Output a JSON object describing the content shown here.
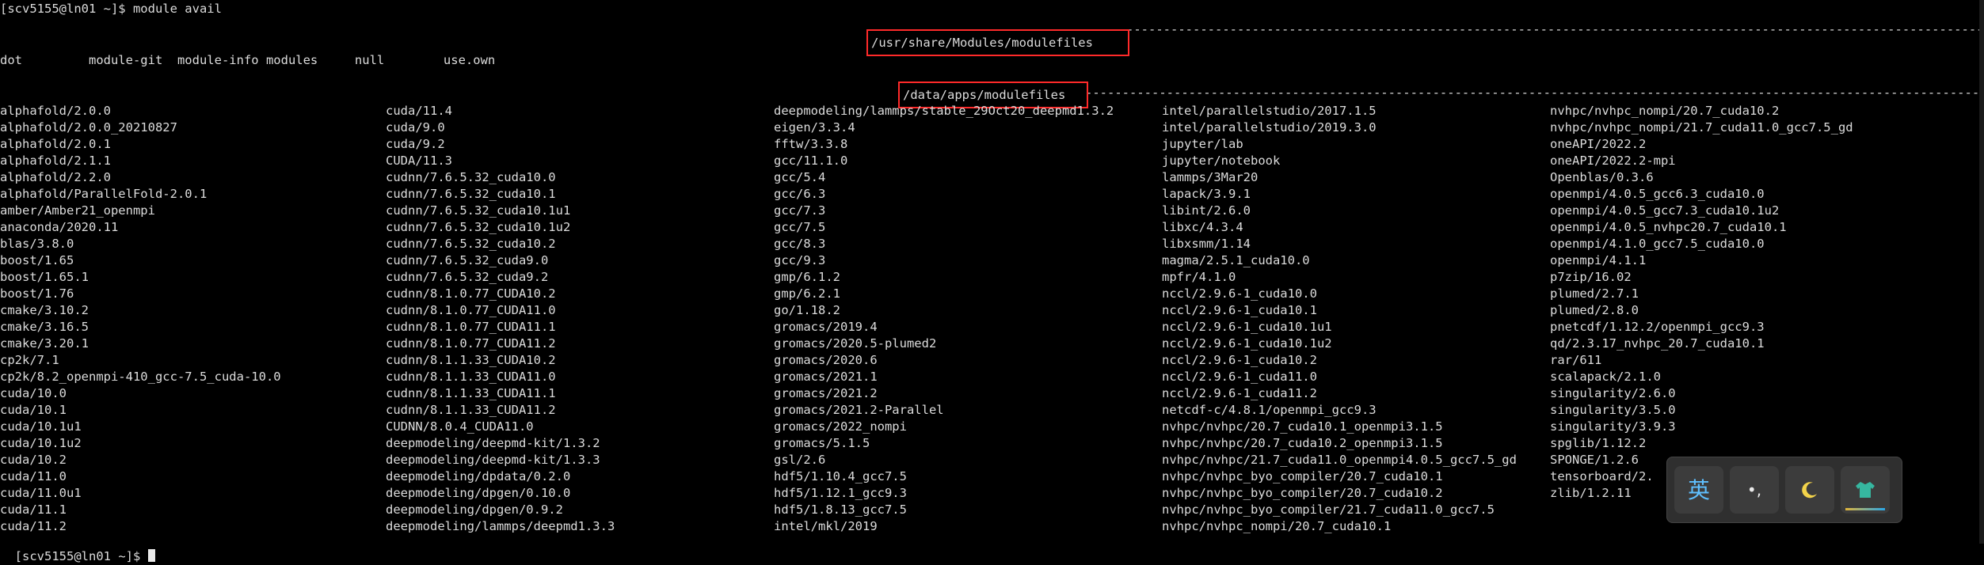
{
  "prompt_line": "[scv5155@ln01 ~]$ module avail",
  "last_prompt": "[scv5155@ln01 ~]$ ",
  "section1": {
    "path": "/usr/share/Modules/modulefiles",
    "dashes_left": "----------------------------------------------------------------------------------------------------------------------------------------------------------------------",
    "dashes_right": "----------------------------------------------------------------------------------------------------------------------------------------------------------------------------",
    "items": "dot         module-git  module-info modules     null        use.own"
  },
  "section2": {
    "path": "/data/apps/modulefiles",
    "dashes_left": "------------------------------------------------------------------------------------------------------------------------------------------------------------------------------",
    "dashes_right": "------------------------------------------------------------------------------------------------------------------------------------------------------------------------------------------------------------------------"
  },
  "columns": [
    [
      "alphafold/2.0.0",
      "alphafold/2.0.0_20210827",
      "alphafold/2.0.1",
      "alphafold/2.1.1",
      "alphafold/2.2.0",
      "alphafold/ParallelFold-2.0.1",
      "amber/Amber21_openmpi",
      "anaconda/2020.11",
      "blas/3.8.0",
      "boost/1.65",
      "boost/1.65.1",
      "boost/1.76",
      "cmake/3.10.2",
      "cmake/3.16.5",
      "cmake/3.20.1",
      "cp2k/7.1",
      "cp2k/8.2_openmpi-410_gcc-7.5_cuda-10.0",
      "cuda/10.0",
      "cuda/10.1",
      "cuda/10.1u1",
      "cuda/10.1u2",
      "cuda/10.2",
      "cuda/11.0",
      "cuda/11.0u1",
      "cuda/11.1",
      "cuda/11.2"
    ],
    [
      "cuda/11.4",
      "cuda/9.0",
      "cuda/9.2",
      "CUDA/11.3",
      "cudnn/7.6.5.32_cuda10.0",
      "cudnn/7.6.5.32_cuda10.1",
      "cudnn/7.6.5.32_cuda10.1u1",
      "cudnn/7.6.5.32_cuda10.1u2",
      "cudnn/7.6.5.32_cuda10.2",
      "cudnn/7.6.5.32_cuda9.0",
      "cudnn/7.6.5.32_cuda9.2",
      "cudnn/8.1.0.77_CUDA10.2",
      "cudnn/8.1.0.77_CUDA11.0",
      "cudnn/8.1.0.77_CUDA11.1",
      "cudnn/8.1.0.77_CUDA11.2",
      "cudnn/8.1.1.33_CUDA10.2",
      "cudnn/8.1.1.33_CUDA11.0",
      "cudnn/8.1.1.33_CUDA11.1",
      "cudnn/8.1.1.33_CUDA11.2",
      "CUDNN/8.0.4_CUDA11.0",
      "deepmodeling/deepmd-kit/1.3.2",
      "deepmodeling/deepmd-kit/1.3.3",
      "deepmodeling/dpdata/0.2.0",
      "deepmodeling/dpgen/0.10.0",
      "deepmodeling/dpgen/0.9.2",
      "deepmodeling/lammps/deepmd1.3.3"
    ],
    [
      "deepmodeling/lammps/stable_29Oct20_deepmd1.3.2",
      "eigen/3.3.4",
      "fftw/3.3.8",
      "gcc/11.1.0",
      "gcc/5.4",
      "gcc/6.3",
      "gcc/7.3",
      "gcc/7.5",
      "gcc/8.3",
      "gcc/9.3",
      "gmp/6.1.2",
      "gmp/6.2.1",
      "go/1.18.2",
      "gromacs/2019.4",
      "gromacs/2020.5-plumed2",
      "gromacs/2020.6",
      "gromacs/2021.1",
      "gromacs/2021.2",
      "gromacs/2021.2-Parallel",
      "gromacs/2022_nompi",
      "gromacs/5.1.5",
      "gsl/2.6",
      "hdf5/1.10.4_gcc7.5",
      "hdf5/1.12.1_gcc9.3",
      "hdf5/1.8.13_gcc7.5",
      "intel/mkl/2019"
    ],
    [
      "intel/parallelstudio/2017.1.5",
      "intel/parallelstudio/2019.3.0",
      "jupyter/lab",
      "jupyter/notebook",
      "lammps/3Mar20",
      "lapack/3.9.1",
      "libint/2.6.0",
      "libxc/4.3.4",
      "libxsmm/1.14",
      "magma/2.5.1_cuda10.0",
      "mpfr/4.1.0",
      "nccl/2.9.6-1_cuda10.0",
      "nccl/2.9.6-1_cuda10.1",
      "nccl/2.9.6-1_cuda10.1u1",
      "nccl/2.9.6-1_cuda10.1u2",
      "nccl/2.9.6-1_cuda10.2",
      "nccl/2.9.6-1_cuda11.0",
      "nccl/2.9.6-1_cuda11.2",
      "netcdf-c/4.8.1/openmpi_gcc9.3",
      "nvhpc/nvhpc/20.7_cuda10.1_openmpi3.1.5",
      "nvhpc/nvhpc/20.7_cuda10.2_openmpi3.1.5",
      "nvhpc/nvhpc/21.7_cuda11.0_openmpi4.0.5_gcc7.5_gd",
      "nvhpc/nvhpc_byo_compiler/20.7_cuda10.1",
      "nvhpc/nvhpc_byo_compiler/20.7_cuda10.2",
      "nvhpc/nvhpc_byo_compiler/21.7_cuda11.0_gcc7.5",
      "nvhpc/nvhpc_nompi/20.7_cuda10.1"
    ],
    [
      "nvhpc/nvhpc_nompi/20.7_cuda10.2",
      "nvhpc/nvhpc_nompi/21.7_cuda11.0_gcc7.5_gd",
      "oneAPI/2022.2",
      "oneAPI/2022.2-mpi",
      "Openblas/0.3.6",
      "openmpi/4.0.5_gcc6.3_cuda10.0",
      "openmpi/4.0.5_gcc7.3_cuda10.1u2",
      "openmpi/4.0.5_nvhpc20.7_cuda10.1",
      "openmpi/4.1.0_gcc7.5_cuda10.0",
      "openmpi/4.1.1",
      "p7zip/16.02",
      "plumed/2.7.1",
      "plumed/2.8.0",
      "pnetcdf/1.12.2/openmpi_gcc9.3",
      "qd/2.3.17_nvhpc_20.7_cuda10.1",
      "rar/611",
      "scalapack/2.1.0",
      "singularity/2.6.0",
      "singularity/3.5.0",
      "singularity/3.9.3",
      "spglib/1.12.2",
      "SPONGE/1.2.6",
      "tensorboard/2.",
      "zlib/1.2.11"
    ]
  ],
  "ime_toolbar": {
    "lang_label": "英",
    "punct_label": "•,",
    "moon_icon": "moon-icon",
    "skin_icon": "shirt-icon",
    "accent": "#2aa7e8"
  },
  "colors": {
    "highlight_box": "#ff2a2a",
    "background": "#000000",
    "text": "#dcdcdc"
  }
}
